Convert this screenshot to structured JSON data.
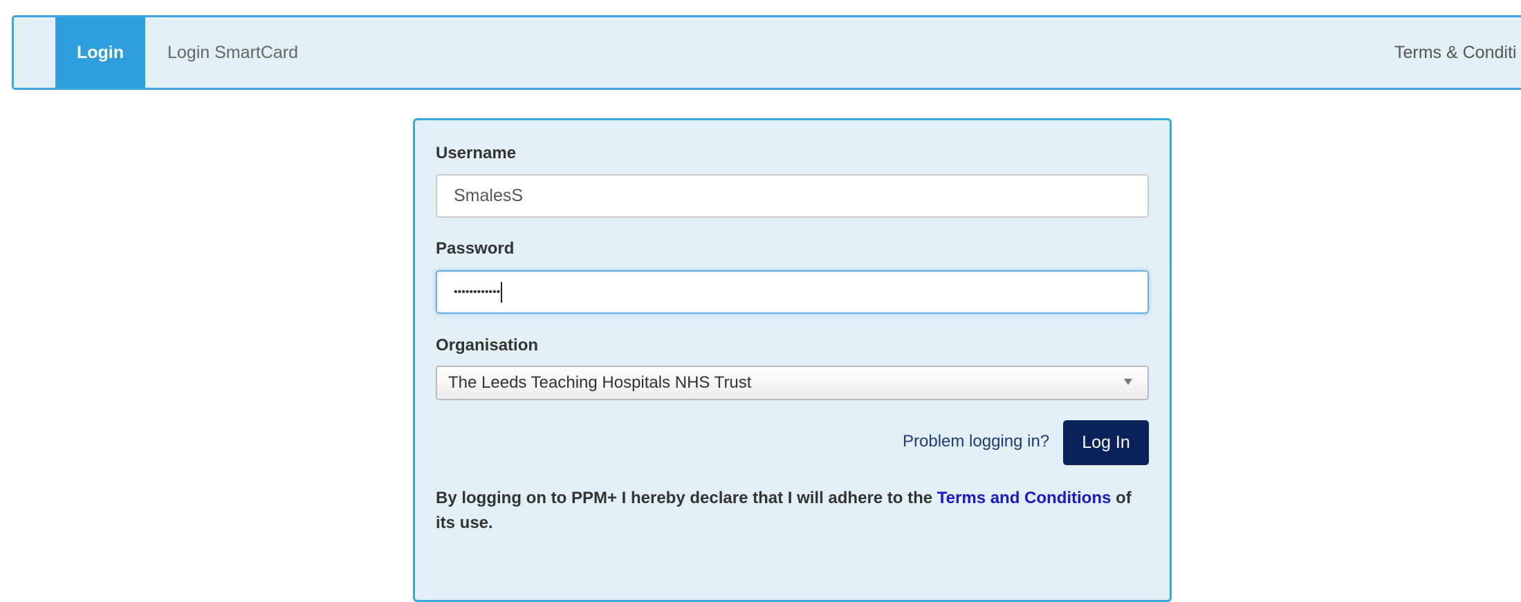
{
  "nav": {
    "tabs": [
      {
        "label": "Login",
        "active": true
      },
      {
        "label": "Login SmartCard",
        "active": false
      }
    ],
    "terms_label": "Terms & Conditi"
  },
  "form": {
    "username": {
      "label": "Username",
      "value": "SmalesS"
    },
    "password": {
      "label": "Password",
      "value": "••••••••••••"
    },
    "organisation": {
      "label": "Organisation",
      "value": "The Leeds Teaching Hospitals NHS Trust"
    },
    "problem_link": "Problem logging in?",
    "login_button": "Log In",
    "declaration": {
      "prefix": "By logging on to PPM+ I hereby declare that I will adhere to the ",
      "link": "Terms and Conditions",
      "suffix": " of its use."
    }
  },
  "colors": {
    "accent": "#2f9fdc",
    "panel_bg": "#e2eff5",
    "button_bg": "#0a2259",
    "link": "#1a1acc"
  }
}
